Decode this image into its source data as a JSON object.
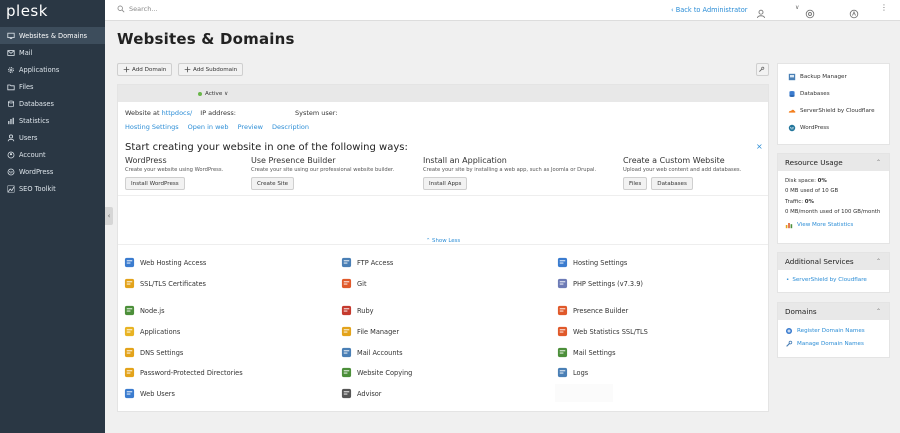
{
  "brand": {
    "logo": "plesk"
  },
  "sidebar": {
    "items": [
      {
        "label": "Websites & Domains",
        "icon": "monitor-icon",
        "active": true
      },
      {
        "label": "Mail",
        "icon": "mail-icon"
      },
      {
        "label": "Applications",
        "icon": "gear-icon"
      },
      {
        "label": "Files",
        "icon": "folder-icon"
      },
      {
        "label": "Databases",
        "icon": "database-icon"
      },
      {
        "label": "Statistics",
        "icon": "bar-chart-icon"
      },
      {
        "label": "Users",
        "icon": "user-icon"
      },
      {
        "label": "Account",
        "icon": "account-icon"
      },
      {
        "label": "WordPress",
        "icon": "wordpress-icon"
      },
      {
        "label": "SEO Toolkit",
        "icon": "seo-icon"
      }
    ]
  },
  "topbar": {
    "search_placeholder": "Search...",
    "back_link": "‹ Back to Administrator"
  },
  "page": {
    "title": "Websites & Domains"
  },
  "toolbar": {
    "add_domain": "Add Domain",
    "add_subdomain": "Add Subdomain"
  },
  "domain": {
    "status": "Active ∨",
    "website_at_label": "Website at",
    "website_at_link": "httpdocs/",
    "ip_label": "IP address:",
    "system_user_label": "System user:",
    "links": [
      "Hosting Settings",
      "Open in web",
      "Preview",
      "Description"
    ]
  },
  "start": {
    "title": "Start creating your website in one of the following ways:",
    "close": "×",
    "options": [
      {
        "title": "WordPress",
        "desc": "Create your website using WordPress.",
        "buttons": [
          "Install WordPress"
        ]
      },
      {
        "title": "Use Presence Builder",
        "desc": "Create your site using our professional website builder.",
        "buttons": [
          "Create Site"
        ]
      },
      {
        "title": "Install an Application",
        "desc": "Create your site by installing a web app, such as Joomla or Drupal.",
        "buttons": [
          "Install Apps"
        ]
      },
      {
        "title": "Create a Custom Website",
        "desc": "Upload your web content and add databases.",
        "buttons": [
          "Files",
          "Databases"
        ]
      }
    ]
  },
  "show_less": "⌃ Show Less",
  "tools": [
    {
      "label": "Web Hosting Access",
      "icon": "web-hosting-access-icon",
      "color": "#3b7ccf"
    },
    {
      "label": "FTP Access",
      "icon": "ftp-icon",
      "color": "#4a7fb5"
    },
    {
      "label": "Hosting Settings",
      "icon": "hosting-settings-icon",
      "color": "#3b7ccf"
    },
    {
      "label": "SSL/TLS Certificates",
      "icon": "lock-icon",
      "color": "#e3a31b"
    },
    {
      "label": "Git",
      "icon": "git-icon",
      "color": "#e0592a"
    },
    {
      "label": "PHP Settings (v7.3.9)",
      "icon": "php-icon",
      "color": "#6d7bb6"
    },
    {
      "label": "Node.js",
      "icon": "nodejs-icon",
      "color": "#4c8f3a"
    },
    {
      "label": "Ruby",
      "icon": "ruby-icon",
      "color": "#c53a2e"
    },
    {
      "label": "Presence Builder",
      "icon": "presence-builder-icon",
      "color": "#e0592a"
    },
    {
      "label": "Applications",
      "icon": "applications-icon",
      "color": "#e8b323"
    },
    {
      "label": "File Manager",
      "icon": "file-manager-icon",
      "color": "#e3a31b"
    },
    {
      "label": "Web Statistics SSL/TLS",
      "icon": "web-statistics-icon",
      "color": "#e0592a"
    },
    {
      "label": "DNS Settings",
      "icon": "dns-icon",
      "color": "#e3a31b"
    },
    {
      "label": "Mail Accounts",
      "icon": "mail-accounts-icon",
      "color": "#4a7fb5"
    },
    {
      "label": "Mail Settings",
      "icon": "mail-settings-icon",
      "color": "#4c8f3a"
    },
    {
      "label": "Password-Protected Directories",
      "icon": "password-dirs-icon",
      "color": "#e3a31b"
    },
    {
      "label": "Website Copying",
      "icon": "website-copying-icon",
      "color": "#4c8f3a"
    },
    {
      "label": "Logs",
      "icon": "logs-icon",
      "color": "#4a7fb5"
    },
    {
      "label": "Web Users",
      "icon": "web-users-icon",
      "color": "#3b7ccf"
    },
    {
      "label": "Advisor",
      "icon": "advisor-icon",
      "color": "#555555"
    }
  ],
  "right": {
    "quick_links": [
      {
        "label": "Backup Manager",
        "icon": "backup-icon"
      },
      {
        "label": "Databases",
        "icon": "database-icon"
      },
      {
        "label": "ServerShield by Cloudflare",
        "icon": "cloudflare-icon"
      },
      {
        "label": "WordPress",
        "icon": "wordpress-icon"
      }
    ],
    "resource_usage": {
      "title": "Resource Usage",
      "disk_label": "Disk space:",
      "disk_value": "0%",
      "disk_detail": "0 MB used of 10 GB",
      "traffic_label": "Traffic:",
      "traffic_value": "0%",
      "traffic_detail": "0 MB/month used of 100 GB/month",
      "link": "View More Statistics"
    },
    "additional_services": {
      "title": "Additional Services",
      "items": [
        "ServerShield by Cloudflare"
      ]
    },
    "domains": {
      "title": "Domains",
      "links": [
        "Register Domain Names",
        "Manage Domain Names"
      ]
    }
  },
  "colors": {
    "sidebar": "#2a3744",
    "sidebar_active": "#3d4d5c",
    "link": "#2b8dd6",
    "active_dot": "#6ab64a"
  }
}
